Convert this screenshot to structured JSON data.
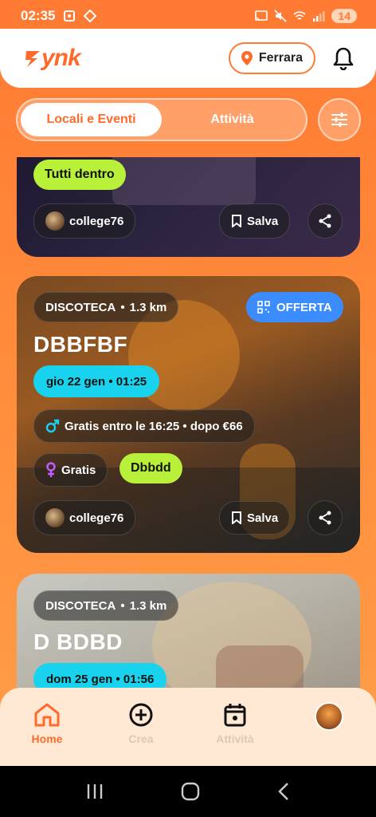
{
  "status_bar": {
    "time": "02:35",
    "battery": "14"
  },
  "header": {
    "logo": "ynk",
    "city": "Ferrara"
  },
  "tabs": [
    {
      "label": "Locali e Eventi"
    },
    {
      "label": "Attività"
    }
  ],
  "cards": [
    {
      "tags": [
        "Tutti dentro"
      ],
      "organizer": "college76",
      "save_label": "Salva"
    },
    {
      "category": "DISCOTECA",
      "distance": "1.3 km",
      "offer_label": "OFFERTA",
      "title": "DBBFBF",
      "date": "gio 22 gen • 01:25",
      "male_price": "Gratis entro le 16:25 • dopo €66",
      "female_price": "Gratis",
      "tag": "Dbbdd",
      "organizer": "college76",
      "save_label": "Salva"
    },
    {
      "category": "DISCOTECA",
      "distance": "1.3 km",
      "title": "D BDBD",
      "date": "dom 25 gen • 01:56"
    }
  ],
  "bottom_nav": [
    {
      "label": "Home"
    },
    {
      "label": "Crea"
    },
    {
      "label": "Attività"
    },
    {
      "label": ""
    }
  ],
  "colors": {
    "accent": "#ff6a2a",
    "green_chip": "#b8f03a",
    "cyan_chip": "#19d3ee",
    "blue_chip": "#3b8cff"
  }
}
